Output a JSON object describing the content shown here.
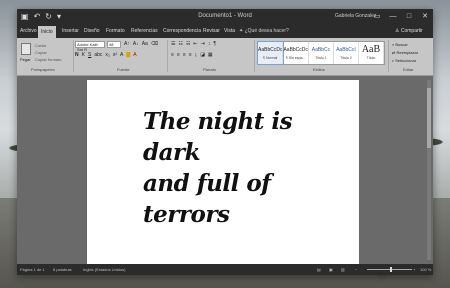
{
  "window": {
    "title": "Documento1 - Word",
    "user": "Gabriela Gonzalez",
    "controls": {
      "restore": "▭",
      "minimize": "—",
      "maximize": "□",
      "close": "✕"
    }
  },
  "qat": {
    "save_icon": "save-icon",
    "undo_icon": "undo-icon",
    "redo_icon": "redo-icon",
    "more": "▾"
  },
  "tabs": [
    "Archivo",
    "Inicio",
    "Insertar",
    "Diseño",
    "Formato",
    "Referencias",
    "Correspondencia",
    "Revisar",
    "Vista"
  ],
  "active_tab": "Inicio",
  "tellme": "¿Qué desea hacer?",
  "share": "Compartir",
  "ribbon": {
    "clipboard": {
      "paste": "Pegar",
      "cut": "Cortar",
      "copy": "Copiar",
      "format_painter": "Copiar formato",
      "group": "Portapapeles"
    },
    "font": {
      "name": "Adobe Kaiti Std R",
      "size": "48",
      "group": "Fuente"
    },
    "paragraph": {
      "group": "Párrafo"
    },
    "styles": {
      "group": "Estilos",
      "items": [
        {
          "preview": "AaBbCcDc",
          "name": "¶ Normal"
        },
        {
          "preview": "AaBbCcDc",
          "name": "¶ Sin espa..."
        },
        {
          "preview": "AaBbCc",
          "name": "Título 1"
        },
        {
          "preview": "AaBbCcI",
          "name": "Título 2"
        },
        {
          "preview": "AaB",
          "name": "Título"
        }
      ]
    },
    "editing": {
      "find": "Buscar",
      "replace": "Reemplazar",
      "select": "Seleccionar",
      "group": "Editar"
    }
  },
  "document": {
    "lines": [
      "The night is dark",
      "and full of",
      "terrors"
    ]
  },
  "statusbar": {
    "page": "Página 1 de 1",
    "words": "8 palabras",
    "language": "Inglés (Estados Unidos)",
    "zoom": "100 %"
  }
}
